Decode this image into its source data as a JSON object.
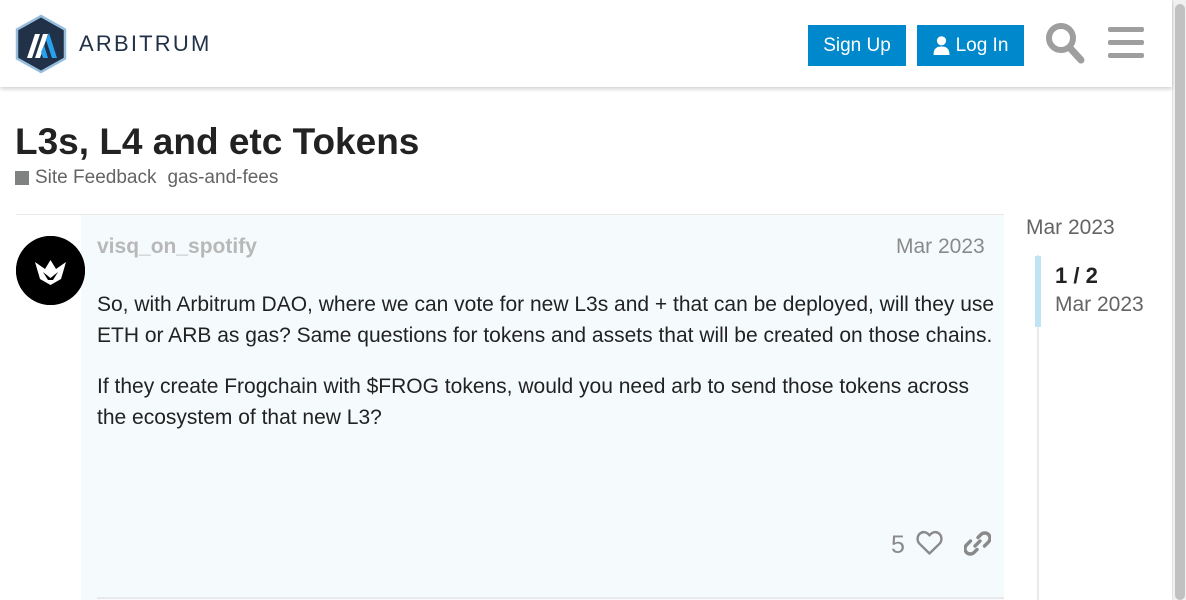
{
  "header": {
    "brand_name": "ARBITRUM",
    "signup_label": "Sign Up",
    "login_label": "Log In"
  },
  "topic": {
    "title": "L3s, L4 and etc Tokens",
    "category": "Site Feedback",
    "tag": "gas-and-fees"
  },
  "post": {
    "username": "visq_on_spotify",
    "date": "Mar 2023",
    "paragraphs": [
      "So, with Arbitrum DAO, where we can vote for new L3s and + that can be deployed, will they use ETH or ARB as gas? Same questions for tokens and assets that will be created on those chains.",
      "If they create Frogchain with $FROG tokens, would you need arb to send those tokens across the ecosystem of that new L3?"
    ],
    "like_count": "5"
  },
  "timeline": {
    "start_date": "Mar 2023",
    "position": "1 / 2",
    "current_date": "Mar 2023"
  },
  "colors": {
    "primary": "#0088cc",
    "brand_navy": "#213147",
    "brand_blue": "#28a0f0",
    "category": "#808281",
    "post_bg": "#f5fbfd"
  },
  "icons": {
    "logo": "arbitrum-logo-icon",
    "login": "user-icon",
    "search": "search-icon",
    "menu": "hamburger-menu-icon",
    "like": "heart-icon",
    "share": "link-icon"
  }
}
